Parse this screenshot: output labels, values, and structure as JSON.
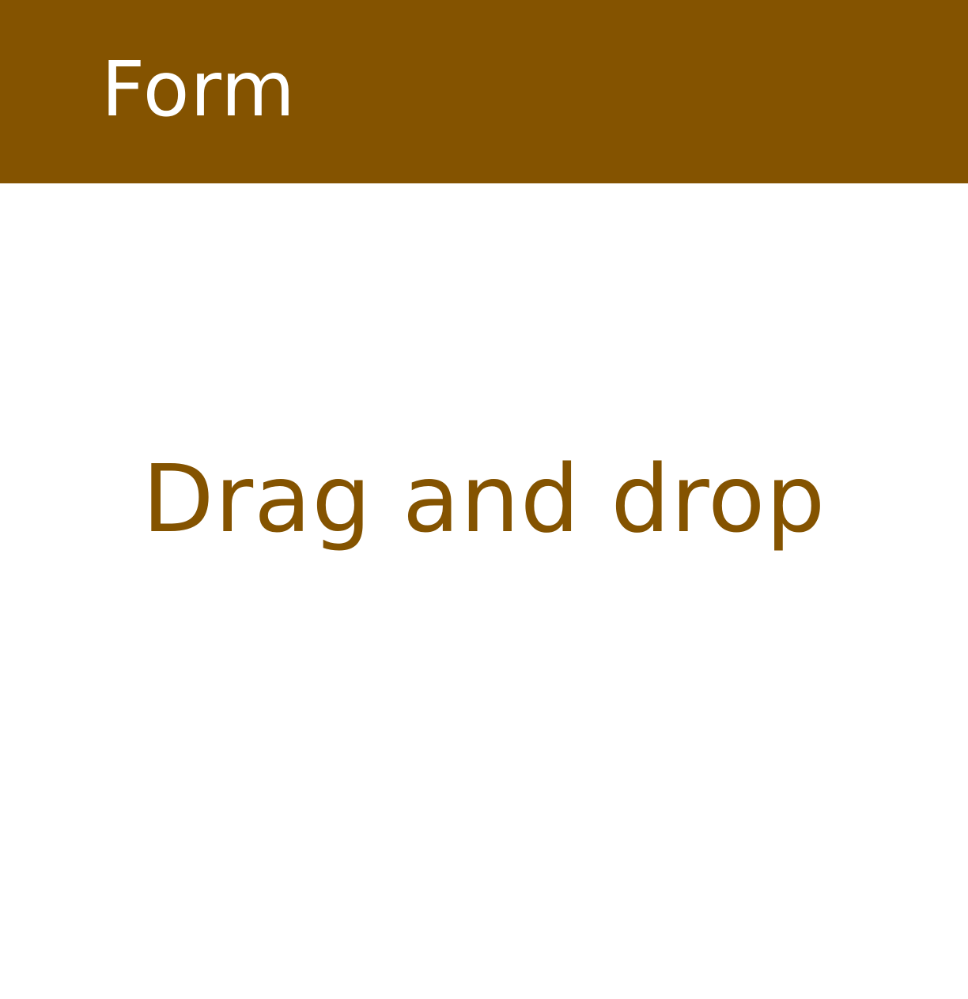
{
  "header": {
    "title": "Form"
  },
  "drop_zone": {
    "label": "Drag and drop"
  },
  "colors": {
    "header_background": "#845300",
    "header_text": "#ffffff",
    "drop_label_text": "#845300",
    "page_background": "#ffffff"
  }
}
